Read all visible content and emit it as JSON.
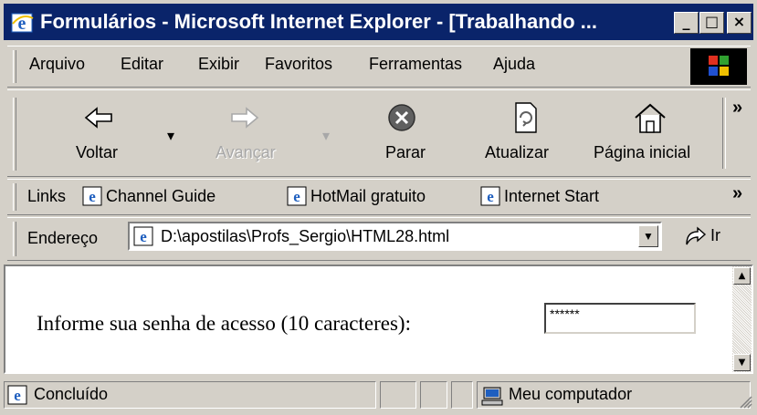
{
  "window": {
    "title": "Formulários - Microsoft Internet Explorer - [Trabalhando ...",
    "controls": [
      "minimize",
      "maximize",
      "close"
    ]
  },
  "menu": {
    "items": [
      "Arquivo",
      "Editar",
      "Exibir",
      "Favoritos",
      "Ferramentas",
      "Ajuda"
    ]
  },
  "toolbar": {
    "back_label": "Voltar",
    "forward_label": "Avançar",
    "stop_label": "Parar",
    "refresh_label": "Atualizar",
    "home_label": "Página inicial",
    "overflow": "»"
  },
  "links_bar": {
    "label": "Links",
    "items": [
      "Channel Guide",
      "HotMail gratuito",
      "Internet Start"
    ],
    "overflow": "»"
  },
  "address_bar": {
    "label": "Endereço",
    "value": "D:\\apostilas\\Profs_Sergio\\HTML28.html",
    "go_label": "Ir"
  },
  "content": {
    "prompt": "Informe sua senha de acesso (10 caracteres):",
    "password_value": "******"
  },
  "status_bar": {
    "status": "Concluído",
    "zone": "Meu computador"
  },
  "colors": {
    "titlebar": "#0a246a",
    "chrome": "#d4d0c8",
    "ie_blue": "#1f5fbf"
  }
}
